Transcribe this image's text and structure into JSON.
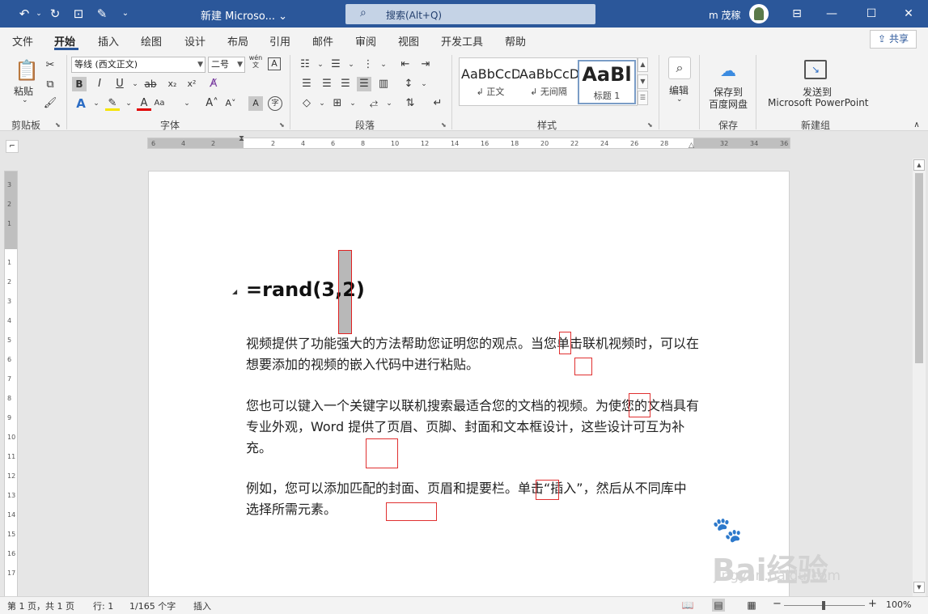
{
  "titlebar": {
    "doc_title": "新建 Microso... ⌄",
    "search_text": "搜索(Alt+Q)",
    "user_name": "m 茂稼"
  },
  "menu": {
    "tabs": [
      "文件",
      "开始",
      "插入",
      "绘图",
      "设计",
      "布局",
      "引用",
      "邮件",
      "审阅",
      "视图",
      "开发工具",
      "帮助"
    ],
    "active": "开始",
    "share": "共享"
  },
  "ribbon": {
    "clipboard": {
      "paste": "粘贴",
      "group": "剪贴板"
    },
    "font": {
      "font_name": "等线 (西文正文)",
      "font_size": "二号",
      "wen": "wén\n文",
      "group": "字体"
    },
    "paragraph": {
      "group": "段落"
    },
    "styles": {
      "group": "样式",
      "items": [
        {
          "preview": "AaBbCcDc",
          "name": "↲ 正文"
        },
        {
          "preview": "AaBbCcDc",
          "name": "↲ 无间隔"
        },
        {
          "preview": "AaBl",
          "name": "标题 1"
        }
      ]
    },
    "editing": {
      "label": "编辑"
    },
    "save": {
      "line1": "保存到",
      "line2": "百度网盘",
      "group": "保存"
    },
    "newgroup": {
      "line1": "发送到",
      "line2": "Microsoft PowerPoint",
      "group": "新建组"
    }
  },
  "ruler": {
    "h_ticks": [
      "6",
      "4",
      "2",
      "",
      "2",
      "4",
      "6",
      "8",
      "10",
      "12",
      "14",
      "16",
      "18",
      "20",
      "22",
      "24",
      "26",
      "28",
      "",
      "32",
      "34",
      "36"
    ],
    "v_ticks": [
      "3",
      "2",
      "1",
      "",
      "1",
      "2",
      "3",
      "4",
      "5",
      "6",
      "7",
      "8",
      "9",
      "10",
      "11",
      "12",
      "13",
      "14",
      "15",
      "16",
      "17"
    ]
  },
  "document": {
    "heading": "=rand(3,2)",
    "paragraphs": [
      "视频提供了功能强大的方法帮助您证明您的观点。当您单击联机视频时，可以在想要添加的视频的嵌入代码中进行粘贴。",
      "您也可以键入一个关键字以联机搜索最适合您的文档的视频。为使您的文档具有专业外观，Word 提供了页眉、页脚、封面和文本框设计，这些设计可互为补充。",
      "例如，您可以添加匹配的封面、页眉和提要栏。单击“插入”，然后从不同库中选择所需元素。"
    ]
  },
  "statusbar": {
    "page": "第 1 页，共 1 页",
    "line": "行: 1",
    "words": "1/165 个字",
    "mode": "插入",
    "zoom": "100%"
  },
  "watermark": {
    "logo": "Bai经验",
    "url": "jingyan.baidu.com"
  },
  "colors": {
    "accent": "#2b579a",
    "highlight_box": "#e02020"
  }
}
